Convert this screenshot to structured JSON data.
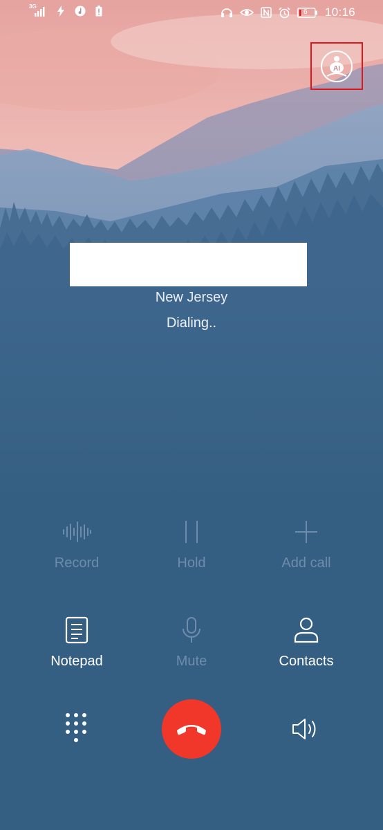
{
  "status_bar": {
    "network_label": "3G",
    "battery_level": "6",
    "time": "10:16"
  },
  "call": {
    "location": "New Jersey",
    "status": "Dialing.."
  },
  "controls": {
    "record": "Record",
    "hold": "Hold",
    "add_call": "Add call",
    "notepad": "Notepad",
    "mute": "Mute",
    "contacts": "Contacts"
  },
  "ai_button_label": "AI",
  "colors": {
    "background": "#355f82",
    "end_call": "#f1362a",
    "highlight_box": "#e0161b"
  },
  "icons": [
    "ai-assistant-icon",
    "waveform-icon",
    "pause-icon",
    "plus-icon",
    "notepad-icon",
    "microphone-icon",
    "person-icon",
    "dialpad-icon",
    "phone-hangup-icon",
    "speaker-icon"
  ]
}
